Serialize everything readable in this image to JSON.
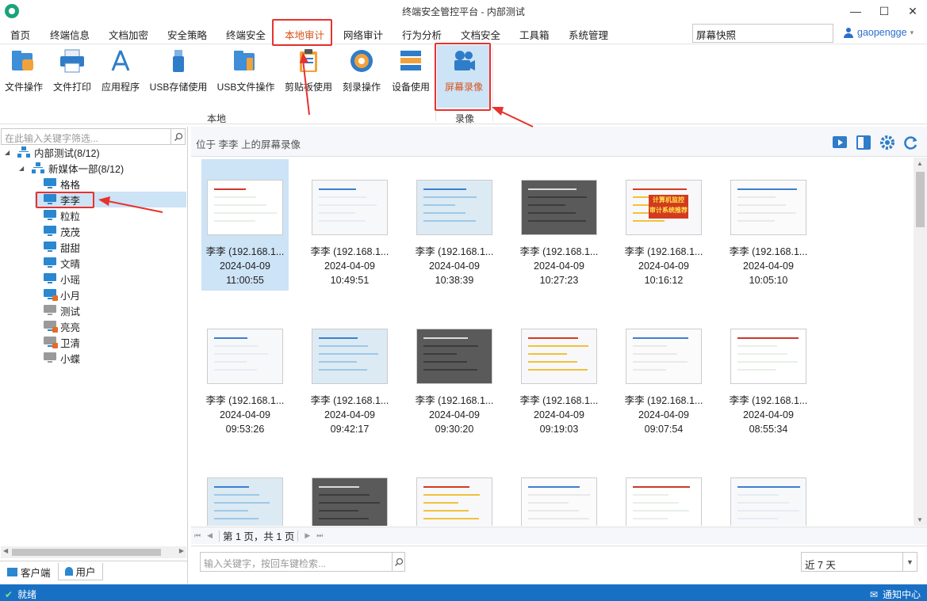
{
  "window": {
    "title": "终端安全管控平台 - 内部测试",
    "minimize": "—",
    "maximize": "☐",
    "close": "✕"
  },
  "menu": {
    "items": [
      "首页",
      "终端信息",
      "文档加密",
      "安全策略",
      "终端安全",
      "本地审计",
      "网络审计",
      "行为分析",
      "文档安全",
      "工具箱",
      "系统管理"
    ],
    "active": "本地审计",
    "search_value": "屏幕快照",
    "user": "gaopengge",
    "user_caret": "▾"
  },
  "ribbon": {
    "tools": [
      "文件操作",
      "文件打印",
      "应用程序",
      "USB存储使用",
      "USB文件操作",
      "剪贴板使用",
      "刻录操作",
      "设备使用"
    ],
    "group_local": "本地",
    "record_tool": "屏幕录像",
    "group_record": "录像"
  },
  "tree": {
    "filter_placeholder": "在此输入关键字筛选...",
    "root": "内部测试(8/12)",
    "dept": "新媒体一部(8/12)",
    "members": [
      "格格",
      "李李",
      "粒粒",
      "茂茂",
      "甜甜",
      "文晴",
      "小瑶",
      "小月",
      "测试",
      "亮亮",
      "卫清",
      "小蝶"
    ],
    "selected": "李李",
    "tab_client": "客户端",
    "tab_user": "用户"
  },
  "main": {
    "location": "位于 李李 上的屏幕录像",
    "thumbs": [
      {
        "name": "李李 (192.168.1...",
        "date": "2024-04-09",
        "time": "11:00:55"
      },
      {
        "name": "李李 (192.168.1...",
        "date": "2024-04-09",
        "time": "10:49:51"
      },
      {
        "name": "李李 (192.168.1...",
        "date": "2024-04-09",
        "time": "10:38:39"
      },
      {
        "name": "李李 (192.168.1...",
        "date": "2024-04-09",
        "time": "10:27:23"
      },
      {
        "name": "李李 (192.168.1...",
        "date": "2024-04-09",
        "time": "10:16:12"
      },
      {
        "name": "李李 (192.168.1...",
        "date": "2024-04-09",
        "time": "10:05:10"
      },
      {
        "name": "李李 (192.168.1...",
        "date": "2024-04-09",
        "time": "09:53:26"
      },
      {
        "name": "李李 (192.168.1...",
        "date": "2024-04-09",
        "time": "09:42:17"
      },
      {
        "name": "李李 (192.168.1...",
        "date": "2024-04-09",
        "time": "09:30:20"
      },
      {
        "name": "李李 (192.168.1...",
        "date": "2024-04-09",
        "time": "09:19:03"
      },
      {
        "name": "李李 (192.168.1...",
        "date": "2024-04-09",
        "time": "09:07:54"
      },
      {
        "name": "李李 (192.168.1...",
        "date": "2024-04-09",
        "time": "08:55:34"
      },
      {
        "name": "",
        "date": "",
        "time": ""
      },
      {
        "name": "",
        "date": "",
        "time": ""
      },
      {
        "name": "",
        "date": "",
        "time": ""
      },
      {
        "name": "",
        "date": "",
        "time": ""
      },
      {
        "name": "",
        "date": "",
        "time": ""
      },
      {
        "name": "",
        "date": "",
        "time": ""
      }
    ],
    "thumb_overlay_text": [
      "计算机监控",
      "审计系统推荐"
    ],
    "pager_text": "第 1 页，共 1 页",
    "search_placeholder": "输入关键字，按回车键检索...",
    "range_value": "近 7 天"
  },
  "status": {
    "text": "就绪",
    "notify": "通知中心"
  },
  "colors": {
    "accent_blue": "#1870c4",
    "highlight_red": "#e8322e",
    "active_orange": "#d9541e",
    "selection": "#cde3f6"
  }
}
